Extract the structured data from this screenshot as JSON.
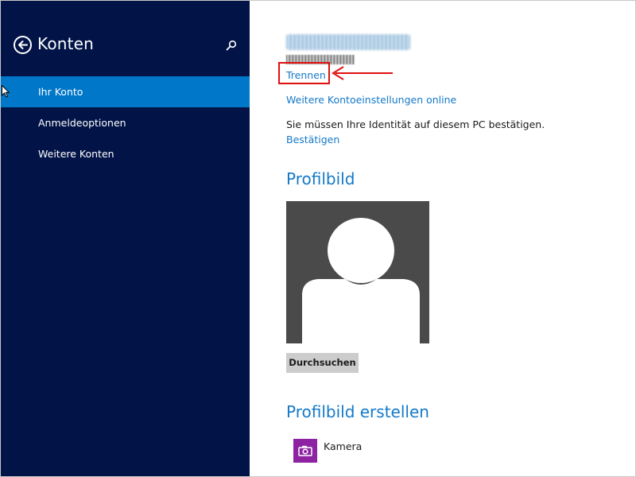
{
  "sidebar": {
    "title": "Konten",
    "items": [
      {
        "label": "Ihr Konto",
        "active": true
      },
      {
        "label": "Anmeldeoptionen",
        "active": false
      },
      {
        "label": "Weitere Konten",
        "active": false
      }
    ],
    "background_color": "#021447",
    "active_color": "#0077c9",
    "back_icon": "back-arrow-circle-icon",
    "search_icon": "search-icon"
  },
  "account": {
    "disconnect_link": "Trennen",
    "more_settings_link": "Weitere Kontoeinstellungen online",
    "verify_message": "Sie müssen Ihre Identität auf diesem PC bestätigen.",
    "verify_link": "Bestätigen"
  },
  "profile_picture": {
    "heading": "Profilbild",
    "browse_button": "Durchsuchen",
    "placeholder_icon": "person-silhouette-icon"
  },
  "create_profile_picture": {
    "heading": "Profilbild erstellen",
    "camera_label": "Kamera",
    "camera_icon": "camera-icon",
    "camera_tile_color": "#8d23a3"
  },
  "annotation": {
    "highlight_color": "#e01010"
  },
  "colors": {
    "link": "#1479c9",
    "text": "#1a1a1a",
    "button": "#cccccc"
  }
}
